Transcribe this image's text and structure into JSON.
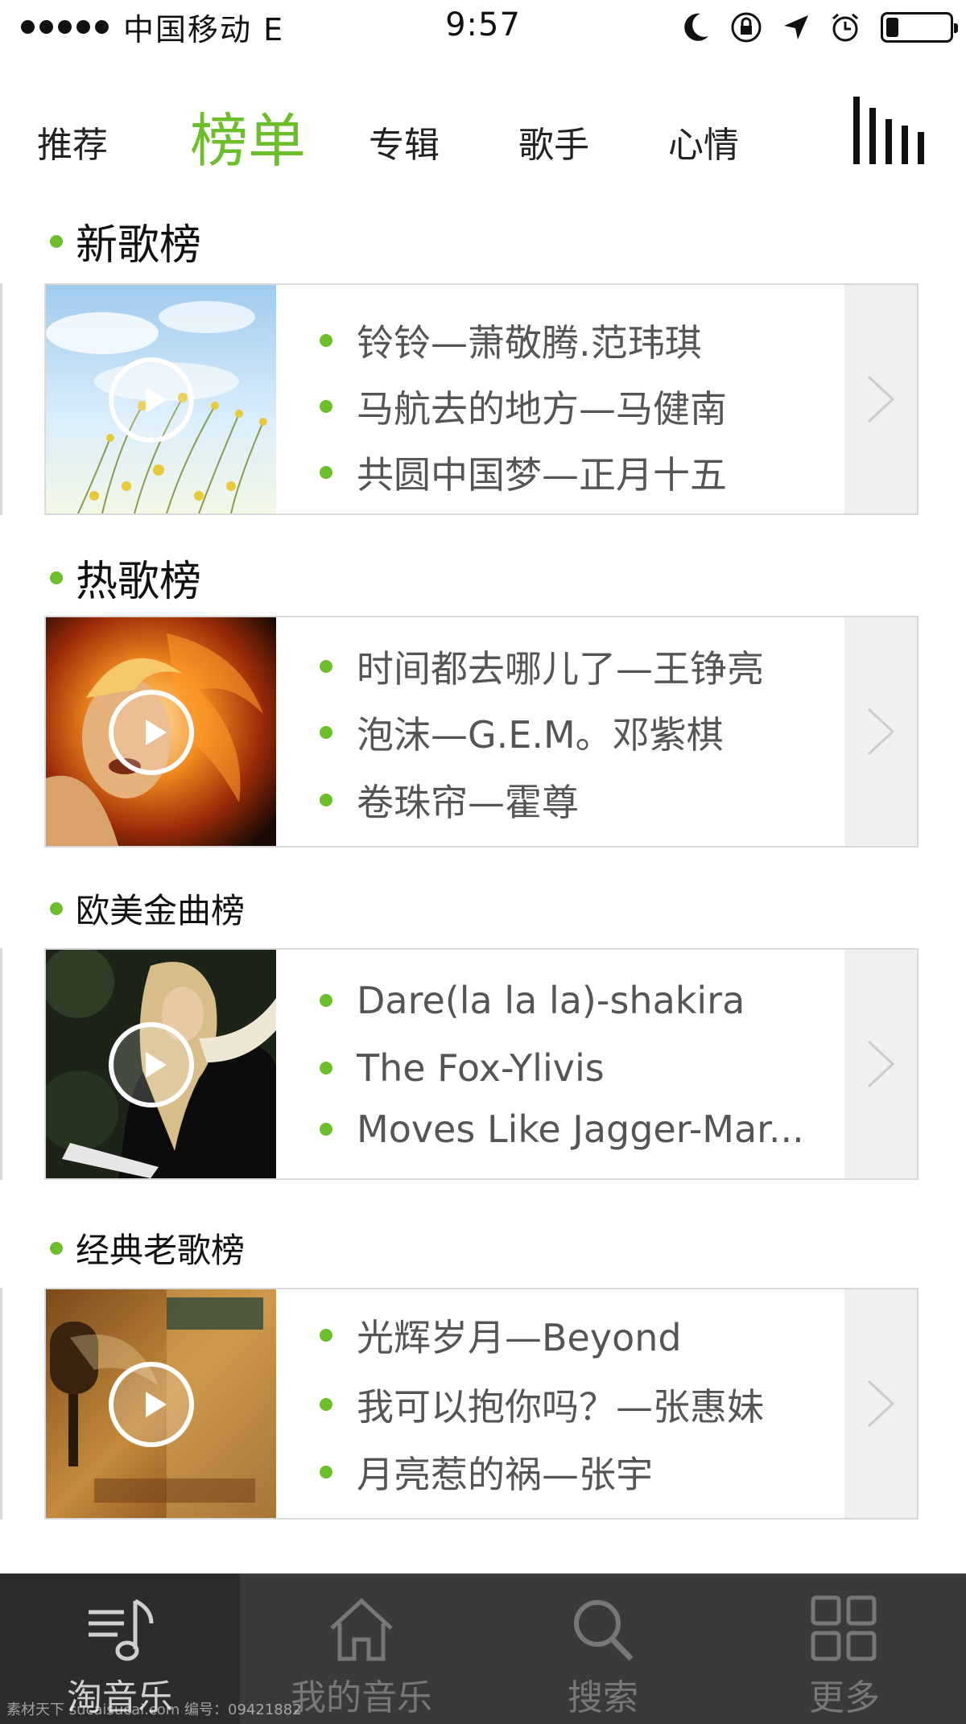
{
  "status_bar": {
    "carrier": "中国移动 E",
    "time": "9:57",
    "battery_level": 0.2
  },
  "tabs": [
    {
      "label": "推荐",
      "active": false
    },
    {
      "label": "榜单",
      "active": true
    },
    {
      "label": "专辑",
      "active": false
    },
    {
      "label": "歌手",
      "active": false
    },
    {
      "label": "心情",
      "active": false
    }
  ],
  "charts": [
    {
      "title": "新歌榜",
      "songs": [
        "铃铃—萧敬腾.范玮琪",
        "马航去的地方—马健南",
        "共圆中国梦—正月十五"
      ],
      "thumb": "meadow-flowers"
    },
    {
      "title": "热歌榜",
      "songs": [
        "时间都去哪儿了—王铮亮",
        "泡沫—G.E.M。邓紫棋",
        "卷珠帘—霍尊"
      ],
      "thumb": "fire-hair-singer"
    },
    {
      "title": "欧美金曲榜",
      "songs": [
        "Dare(la la la)-shakira",
        "The Fox-Ylivis",
        "Moves Like Jagger-Mar..."
      ],
      "thumb": "blonde-singer-piano"
    },
    {
      "title": "经典老歌榜",
      "songs": [
        "光辉岁月—Beyond",
        "我可以抱你吗？—张惠妹",
        "月亮惹的祸—张宇"
      ],
      "thumb": "vintage-microphone-poster"
    }
  ],
  "bottom_nav": [
    {
      "label": "淘音乐",
      "icon": "music-note-icon",
      "active": true
    },
    {
      "label": "我的音乐",
      "icon": "home-icon",
      "active": false
    },
    {
      "label": "搜索",
      "icon": "search-icon",
      "active": false
    },
    {
      "label": "更多",
      "icon": "grid-icon",
      "active": false
    }
  ],
  "watermark": "素材天下 sucaisucai.com 编号：09421882",
  "colors": {
    "accent": "#6cbf2a",
    "nav_bg": "#3a3a3a",
    "text": "#555555"
  }
}
